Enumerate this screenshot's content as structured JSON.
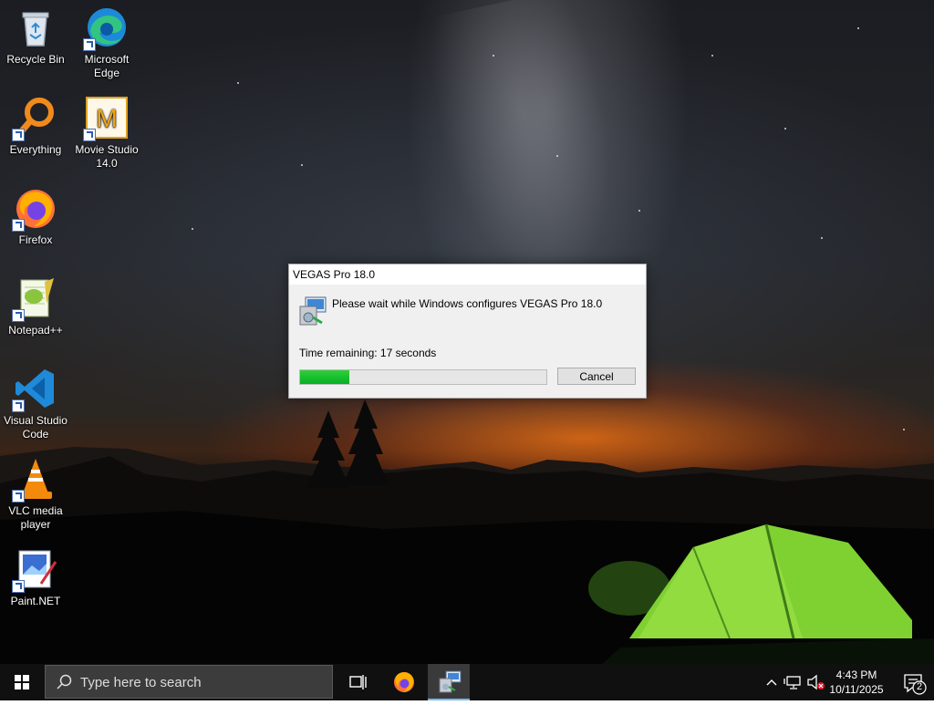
{
  "desktop_icons": [
    {
      "name": "recycle-bin",
      "label": "Recycle Bin",
      "icon": "recycle-bin-icon"
    },
    {
      "name": "microsoft-edge",
      "label": "Microsoft Edge",
      "icon": "edge-icon"
    },
    {
      "name": "everything",
      "label": "Everything",
      "icon": "everything-search-icon"
    },
    {
      "name": "movie-studio",
      "label": "Movie Studio 14.0",
      "icon": "movie-studio-icon"
    },
    {
      "name": "firefox",
      "label": "Firefox",
      "icon": "firefox-icon"
    },
    {
      "name": "notepad-plus-plus",
      "label": "Notepad++",
      "icon": "notepad-plus-plus-icon"
    },
    {
      "name": "visual-studio-code",
      "label": "Visual Studio Code",
      "icon": "vscode-icon"
    },
    {
      "name": "vlc",
      "label": "VLC media player",
      "icon": "vlc-icon"
    },
    {
      "name": "paint-net",
      "label": "Paint.NET",
      "icon": "paint-net-icon"
    }
  ],
  "dialog": {
    "title": "VEGAS Pro 18.0",
    "message": "Please wait while Windows configures VEGAS Pro 18.0",
    "time_remaining": "Time remaining: 17 seconds",
    "progress": 0.2,
    "cancel_label": "Cancel",
    "icon": "windows-installer-icon"
  },
  "taskbar": {
    "search_placeholder": "Type here to search",
    "pinned": [
      "firefox-icon",
      "windows-installer-icon"
    ],
    "active_app": "windows-installer"
  },
  "tray": {
    "time": "4:43 PM",
    "date": "10/11/2025",
    "notification_count": "2",
    "volume_muted": true
  },
  "colors": {
    "progress_fill": "#06b025",
    "taskbar_bg": "#101010",
    "active_indicator": "#76b9ed"
  }
}
